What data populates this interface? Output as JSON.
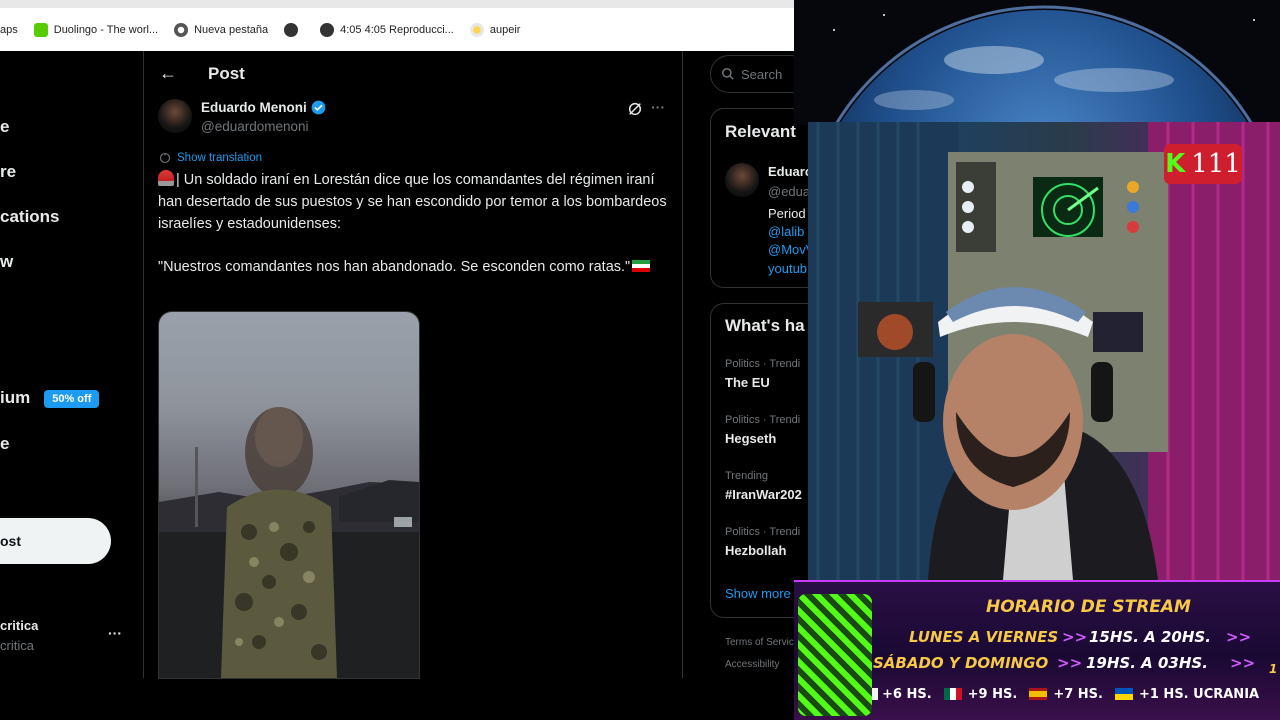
{
  "bookmarks": [
    {
      "label": "aps",
      "icon": "maps-icon"
    },
    {
      "label": "Duolingo - The worl...",
      "icon": "duolingo-icon"
    },
    {
      "label": "Nueva pestaña",
      "icon": "chrome-icon"
    },
    {
      "label": "",
      "icon": "globe-icon"
    },
    {
      "label": "4:05 4:05 Reproducci...",
      "icon": "globe-icon"
    },
    {
      "label": "aupeir",
      "icon": "sparkle-icon"
    }
  ],
  "nav": {
    "items": [
      "e",
      "re",
      "cations",
      "w",
      "ium",
      "e"
    ],
    "premium_badge": "50% off",
    "post_button": "ost",
    "account_name": "critica",
    "account_handle": "critica",
    "more": "···"
  },
  "header": {
    "back": "←",
    "title": "Post"
  },
  "post": {
    "author_name": "Eduardo Menoni",
    "author_handle": "@eduardomenoni",
    "show_translation": "Show translation",
    "text1": "| Un soldado iraní en Lorestán dice que los comandantes del régimen iraní han desertado de sus puestos y se han escondido por temor a los bombardeos israelíes y estadounidenses:",
    "text2": "\"Nuestros comandantes nos han abandonado. Se esconden como ratas.\""
  },
  "search": {
    "placeholder": "Search"
  },
  "relevant": {
    "title": "Relevant",
    "name": "Eduarc",
    "handle": "@edua",
    "bio": "Period",
    "link1": "@lalib",
    "link2": "@MovV",
    "link3": "youtub"
  },
  "trends": {
    "title": "What's ha",
    "items": [
      {
        "meta": "Politics · Trendi",
        "name": "The EU"
      },
      {
        "meta": "Politics · Trendi",
        "name": "Hegseth"
      },
      {
        "meta": "Trending",
        "name": "#IranWar202"
      },
      {
        "meta": "Politics · Trendi",
        "name": "Hezbollah"
      }
    ],
    "show_more": "Show more"
  },
  "footer": {
    "terms": "Terms of Servic",
    "accessibility": "Accessibility"
  },
  "stream": {
    "kick_count": "111",
    "banner_title": "HORARIO DE STREAM",
    "row1_days": "LUNES A VIERNES",
    "row1_time": "15HS. A 20HS.",
    "row2_days": "SÁBADO Y DOMINGO",
    "row2_time": "19HS. A 03HS.",
    "zones": [
      "+6 HS.",
      "+9 HS.",
      "+7 HS.",
      "+1 HS. UCRANIA"
    ],
    "edge_char": "1"
  },
  "colors": {
    "accent": "#1d9bf0",
    "background": "#000000",
    "kick_green": "#53fc18"
  }
}
